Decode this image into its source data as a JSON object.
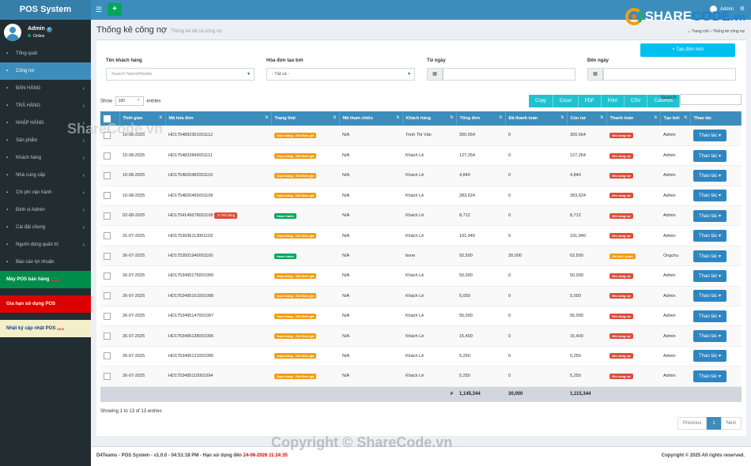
{
  "sidebar": {
    "brand": "POS System",
    "user_name": "Admin",
    "user_status": "Online",
    "items": [
      {
        "label": "Tổng quát",
        "icon": "dashboard-icon",
        "state": "normal",
        "arrow": false
      },
      {
        "label": "Công nợ",
        "icon": "money-icon",
        "state": "active",
        "arrow": false
      },
      {
        "label": "BÁN HÀNG",
        "icon": "cart-icon",
        "state": "normal",
        "arrow": true
      },
      {
        "label": "TRẢ HÀNG",
        "icon": "return-icon",
        "state": "normal",
        "arrow": true
      },
      {
        "label": "NHẬP HÀNG",
        "icon": "import-icon",
        "state": "normal",
        "arrow": true
      },
      {
        "label": "Sản phẩm",
        "icon": "box-icon",
        "state": "normal",
        "arrow": true
      },
      {
        "label": "Khách hàng",
        "icon": "users-icon",
        "state": "normal",
        "arrow": true
      },
      {
        "label": "Nhà cung cấp",
        "icon": "truck-icon",
        "state": "normal",
        "arrow": true
      },
      {
        "label": "Chi phí vận hành",
        "icon": "chart-icon",
        "state": "normal",
        "arrow": true
      },
      {
        "label": "Định vị Admin",
        "icon": "map-marker-icon",
        "state": "normal",
        "arrow": true
      },
      {
        "label": "Cài đặt chung",
        "icon": "gear-icon",
        "state": "normal",
        "arrow": true
      },
      {
        "label": "Người dùng quản trị",
        "icon": "user-shield-icon",
        "state": "normal",
        "arrow": true
      },
      {
        "label": "Báo cáo lợi nhuận",
        "icon": "report-icon",
        "state": "normal",
        "arrow": false
      }
    ],
    "pos_item": {
      "label": "Máy POS bán hàng",
      "sup": "Admin"
    },
    "limit_item": {
      "label": "Gia hạn sử dụng POS"
    },
    "log_item": {
      "label": "Nhật ký cập nhật POS",
      "sup": "NEW"
    }
  },
  "topbar": {
    "user": "Admin"
  },
  "logo": {
    "part1": "SHARE",
    "part2": "CODE",
    "part3": ".vn"
  },
  "page": {
    "title": "Thống kê công nợ",
    "subtitle": "Thống kê tất cả công nợ",
    "breadcrumb_home": "Trang chủ",
    "breadcrumb_sep": "›",
    "breadcrumb_current": "Thống kê công nợ"
  },
  "filters": {
    "create_button": "+ Tạo đơn mới",
    "customer_label": "Tên khách hàng",
    "customer_placeholder": "Search Name/Mobile",
    "creator_label": "Hóa đơn tạo bởi",
    "creator_value": "- Tất cả -",
    "from_label": "Từ ngày",
    "to_label": "Đến ngày"
  },
  "table_controls": {
    "show_label": "Show",
    "show_value": "100",
    "entries_label": "entries",
    "export_buttons": [
      "Copy",
      "Excel",
      "PDF",
      "Print",
      "CSV",
      "Columns"
    ],
    "search_label": "Search:"
  },
  "table": {
    "headers": [
      "Thời gian",
      "Mã hóa đơn",
      "Trạng thái",
      "Mã tham chiếu",
      "Khách hàng",
      "Tổng đơn",
      "Đã thanh toán",
      "Còn nợ",
      "Thanh toán",
      "Tạo bởi",
      "Thao tác"
    ],
    "action_label": "Thao tác",
    "rows": [
      {
        "date": "10-08-2025",
        "code": "HD1754892301001112",
        "returned": false,
        "status": "Soạn hàng - Giữ Đơn giá",
        "status_type": "orange",
        "ref": "N/A",
        "customer": "Trịnh Thị Vân",
        "total": "300,564",
        "paid": "0",
        "debt": "300,564",
        "payment": "Ghi công nợ",
        "payment_type": "red",
        "by": "Admin"
      },
      {
        "date": "10-08-2025",
        "code": "HD1754832849001111",
        "returned": false,
        "status": "Soạn hàng - Giữ Đơn giá",
        "status_type": "orange",
        "ref": "N/A",
        "customer": "Khách Lẻ",
        "total": "127,264",
        "paid": "0",
        "debt": "127,264",
        "payment": "Ghi công nợ",
        "payment_type": "red",
        "by": "Admin"
      },
      {
        "date": "10-08-2025",
        "code": "HD1754820482001110",
        "returned": false,
        "status": "Soạn hàng - Giữ Đơn giá",
        "status_type": "orange",
        "ref": "N/A",
        "customer": "Khách Lẻ",
        "total": "4,840",
        "paid": "0",
        "debt": "4,840",
        "payment": "Ghi công nợ",
        "payment_type": "red",
        "by": "Admin"
      },
      {
        "date": "10-08-2025",
        "code": "HD1754820465001109",
        "returned": false,
        "status": "Soạn hàng - Giữ Đơn giá",
        "status_type": "orange",
        "ref": "N/A",
        "customer": "Khách Lẻ",
        "total": "283,624",
        "paid": "0",
        "debt": "283,624",
        "payment": "Ghi công nợ",
        "payment_type": "red",
        "by": "Admin"
      },
      {
        "date": "02-08-2025",
        "code": "HD1754149678001108",
        "returned": true,
        "return_label": "Trả hàng",
        "status": "Hoàn thành",
        "status_type": "green",
        "ref": "N/A",
        "customer": "Khách Lẻ",
        "total": "8,712",
        "paid": "0",
        "debt": "8,712",
        "payment": "Ghi công nợ",
        "payment_type": "red",
        "by": "Admin"
      },
      {
        "date": "31-07-2025",
        "code": "HD1753936113001103",
        "returned": false,
        "status": "Soạn hàng - Giữ Đơn giá",
        "status_type": "orange",
        "ref": "N/A",
        "customer": "Khách Lẻ",
        "total": "191,940",
        "paid": "0",
        "debt": "191,940",
        "payment": "Ghi công nợ",
        "payment_type": "red",
        "by": "Admin"
      },
      {
        "date": "26-07-2025",
        "code": "HD1753501940001100",
        "returned": false,
        "status": "Hoàn thành",
        "status_type": "green",
        "ref": "N/A",
        "customer": "bone",
        "total": "92,500",
        "paid": "30,000",
        "debt": "62,500",
        "payment": "Chỉ trả 1 phần",
        "payment_type": "orange",
        "by": "Ongchu"
      },
      {
        "date": "26-07-2025",
        "code": "HD1753495175001099",
        "returned": false,
        "status": "Soạn hàng - Giữ Đơn giá",
        "status_type": "orange",
        "ref": "N/A",
        "customer": "Khách Lẻ",
        "total": "50,000",
        "paid": "0",
        "debt": "50,000",
        "payment": "Ghi công nợ",
        "payment_type": "red",
        "by": "Admin"
      },
      {
        "date": "26-07-2025",
        "code": "HD1753495161001098",
        "returned": false,
        "status": "Soạn hàng - Giữ Đơn giá",
        "status_type": "orange",
        "ref": "N/A",
        "customer": "Khách Lẻ",
        "total": "5,000",
        "paid": "0",
        "debt": "5,000",
        "payment": "Ghi công nợ",
        "payment_type": "red",
        "by": "Admin"
      },
      {
        "date": "26-07-2025",
        "code": "HD1753495147001097",
        "returned": false,
        "status": "Soạn hàng - Giữ Đơn giá",
        "status_type": "orange",
        "ref": "N/A",
        "customer": "Khách Lẻ",
        "total": "55,000",
        "paid": "0",
        "debt": "55,000",
        "payment": "Ghi công nợ",
        "payment_type": "red",
        "by": "Admin"
      },
      {
        "date": "26-07-2025",
        "code": "HD1753495138001096",
        "returned": false,
        "status": "Soạn hàng - Giữ Đơn giá",
        "status_type": "orange",
        "ref": "N/A",
        "customer": "Khách Lẻ",
        "total": "15,400",
        "paid": "0",
        "debt": "15,400",
        "payment": "Ghi công nợ",
        "payment_type": "red",
        "by": "Admin"
      },
      {
        "date": "26-07-2025",
        "code": "HD1753495121001095",
        "returned": false,
        "status": "Soạn hàng - Giữ Đơn giá",
        "status_type": "orange",
        "ref": "N/A",
        "customer": "Khách Lẻ",
        "total": "5,250",
        "paid": "0",
        "debt": "5,250",
        "payment": "Ghi công nợ",
        "payment_type": "red",
        "by": "Admin"
      },
      {
        "date": "26-07-2025",
        "code": "HD1753495110001094",
        "returned": false,
        "status": "Soạn hàng - Giữ Đơn giá",
        "status_type": "orange",
        "ref": "N/A",
        "customer": "Khách Lẻ",
        "total": "5,250",
        "paid": "0",
        "debt": "5,250",
        "payment": "Ghi công nợ",
        "payment_type": "red",
        "by": "Admin"
      }
    ],
    "footer": {
      "hash": "#",
      "total": "1,145,344",
      "paid": "30,000",
      "debt": "1,115,344"
    }
  },
  "pagination": {
    "info": "Showing 1 to 13 of 13 entries",
    "previous": "Previous",
    "page": "1",
    "next": "Next"
  },
  "footer": {
    "left_prefix": "D4Teams - POS System - v1.0.0 - 04:51:18 PM - Hạn sử dụng đến",
    "expiry": "24-06-2026 11:24:35",
    "right": "Copyright © 2025 All rights reserved."
  },
  "watermarks": {
    "top": "ShareCode.vn",
    "bottom": "Copyright © ShareCode.vn"
  },
  "colors": {
    "primary": "#3c8dbc",
    "sidebar": "#222d32",
    "success": "#00a65a",
    "warning": "#f39c12",
    "danger": "#dd4b39",
    "info": "#00c0ef"
  }
}
